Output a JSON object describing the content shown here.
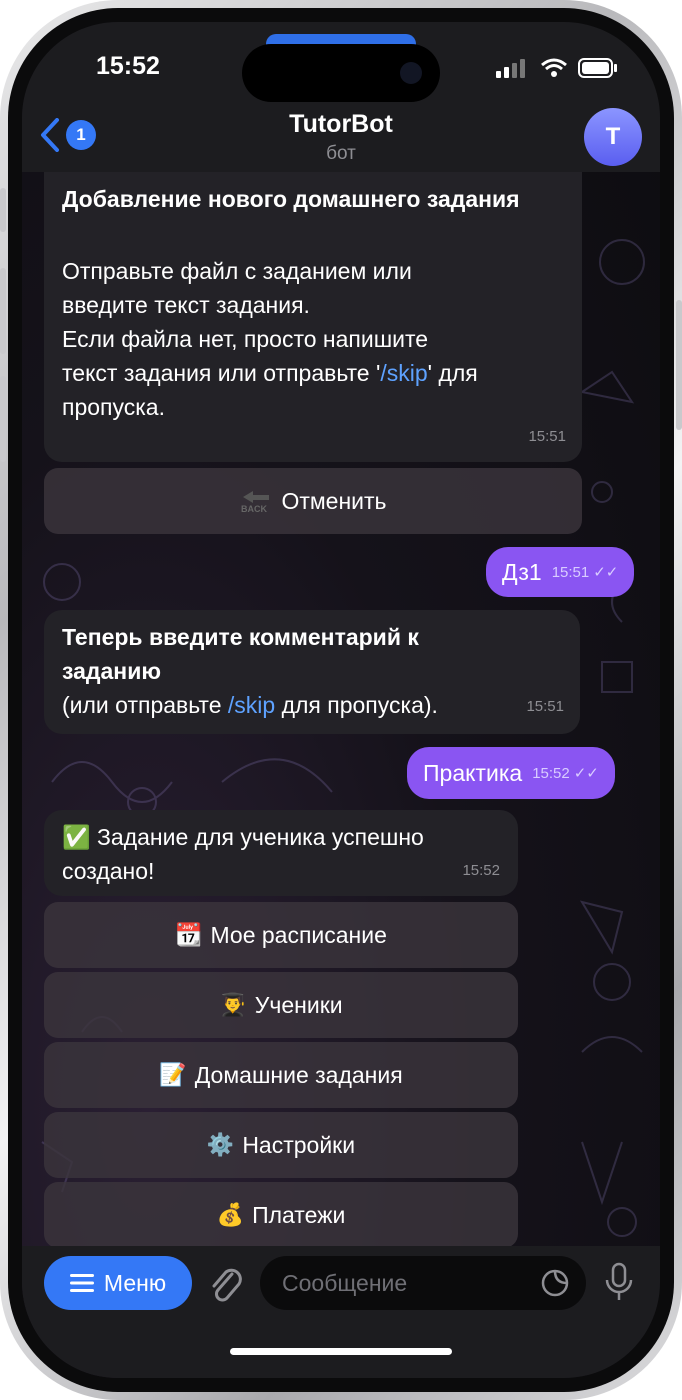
{
  "status": {
    "time": "15:52"
  },
  "header": {
    "back_badge": "1",
    "title": "TutorBot",
    "subtitle": "бот",
    "avatar_letter": "T"
  },
  "messages": [
    {
      "title": "Добавление нового домашнего задания",
      "line1": "Отправьте файл с заданием или",
      "line2": "введите текст задания.",
      "line3": "Если файла нет, просто напишите",
      "line4_pre": "текст задания или отправьте '",
      "line4_link": "/skip",
      "line4_post": "' для",
      "line5": "пропуска.",
      "time": "15:51"
    },
    {
      "text": "Дз1",
      "time": "15:51"
    },
    {
      "title1": "Теперь введите комментарий к",
      "title2": "заданию",
      "pre": "(или отправьте ",
      "link": "/skip",
      "post": " для пропуска).",
      "time": "15:51"
    },
    {
      "text": "Практика",
      "time": "15:52"
    },
    {
      "line1": "✅ Задание для ученика успешно",
      "line2": "создано!",
      "time": "15:52"
    }
  ],
  "inline_buttons": {
    "cancel": {
      "icon": "back-arrow-icon",
      "label": "Отменить"
    }
  },
  "keyboard": [
    {
      "icon": "📆",
      "label": "Мое расписание"
    },
    {
      "icon": "👨‍🎓",
      "label": "Ученики"
    },
    {
      "icon": "📝",
      "label": "Домашние задания"
    },
    {
      "icon": "⚙️",
      "label": "Настройки"
    },
    {
      "icon": "💰",
      "label": "Платежи"
    }
  ],
  "composer": {
    "menu_label": "Меню",
    "placeholder": "Сообщение"
  },
  "colors": {
    "outgoing": "#8a55f2",
    "link": "#5ea2ff",
    "accent": "#3478f6"
  }
}
